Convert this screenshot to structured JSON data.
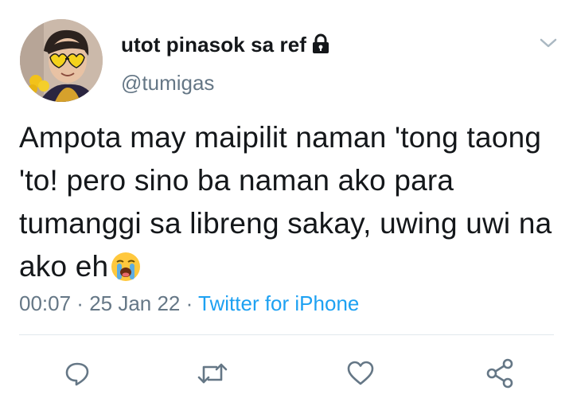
{
  "user": {
    "display_name": "utot pinasok sa ref",
    "handle": "@tumigas",
    "protected_icon": "lock-icon"
  },
  "tweet": {
    "text": "Ampota may maipilit naman 'tong taong 'to! pero sino ba naman ako para tumanggi sa libreng sakay, uwing uwi na ako eh",
    "emoji": "loudly-crying-face"
  },
  "meta": {
    "time": "00:07",
    "separator": " · ",
    "date": "25 Jan 22",
    "source": "Twitter for iPhone"
  },
  "actions": [
    "reply-icon",
    "retweet-icon",
    "like-icon",
    "share-icon"
  ],
  "colors": {
    "text": "#14171a",
    "secondary": "#657786",
    "link": "#1da1f2",
    "divider": "#e1e8ed"
  }
}
